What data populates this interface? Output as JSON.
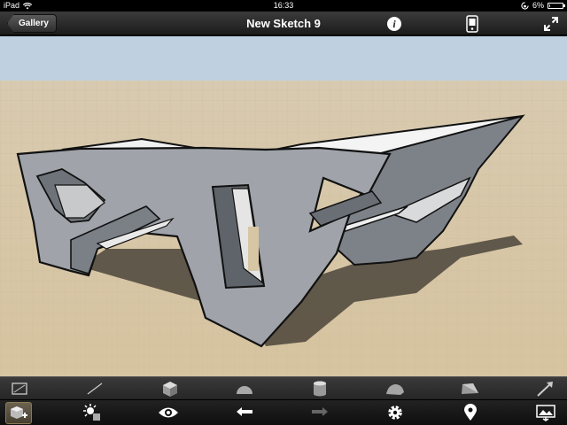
{
  "status_bar": {
    "device": "iPad",
    "time": "16:33",
    "battery": "6%",
    "battery_level": 0.06
  },
  "nav_bar": {
    "back_label": "Gallery",
    "title": "New Sketch 9"
  },
  "shape_tools": [
    "rectangle-icon",
    "line-icon",
    "box-icon",
    "dome-icon",
    "cylinder-icon",
    "rock-icon",
    "wedge-icon",
    "arrow-icon"
  ],
  "action_tools": [
    "add-layer-icon",
    "lighting-icon",
    "eye-icon",
    "undo-icon",
    "redo-icon",
    "settings-icon",
    "location-pin-icon",
    "image-export-icon"
  ],
  "colors": {
    "sky": "#bdd0e0",
    "floor": "#d9c8a8",
    "model": "#9a9fa6",
    "shadow": "#4a4339",
    "active_tool": "#5e5542"
  }
}
